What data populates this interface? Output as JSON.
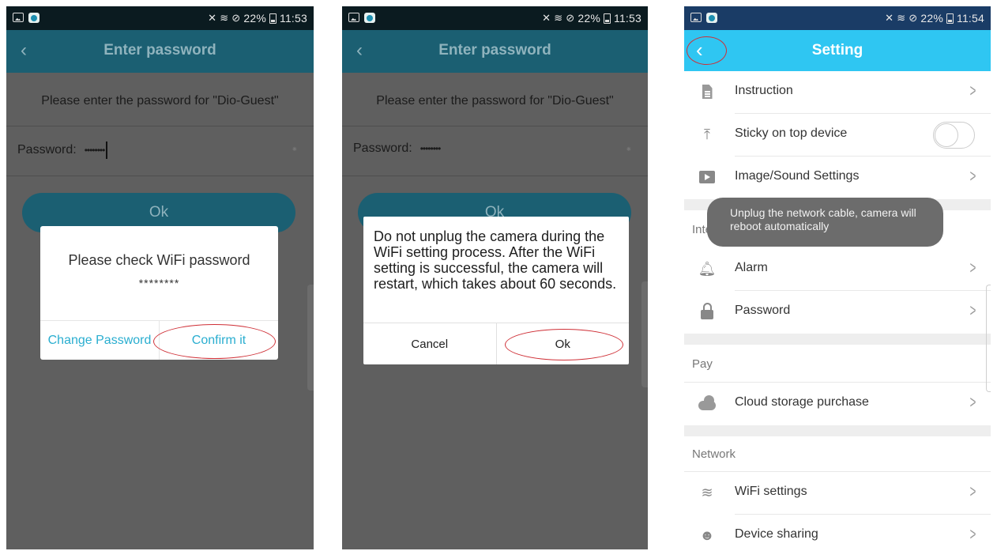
{
  "status": {
    "time_1": "11:53",
    "time_2": "11:53",
    "time_3": "11:54",
    "battery": "22%"
  },
  "screen1": {
    "title": "Enter password",
    "prompt": "Please enter the password for \"Dio-Guest\"",
    "password_label": "Password:",
    "password_value": "••••••••",
    "ok_label": "Ok",
    "dialog": {
      "message": "Please check WiFi password",
      "masked": "********",
      "change_label": "Change Password",
      "confirm_label": "Confirm it"
    }
  },
  "screen2": {
    "title": "Enter password",
    "prompt": "Please enter the password for \"Dio-Guest\"",
    "password_label": "Password:",
    "password_value": "••••••••",
    "ok_label": "Ok",
    "dialog": {
      "message": "Do not unplug the camera during the WiFi setting process. After the WiFi setting is successful, the camera will restart, which takes about 60 seconds.",
      "cancel_label": "Cancel",
      "ok_label": "Ok"
    }
  },
  "screen3": {
    "title": "Setting",
    "rows": {
      "instruction": "Instruction",
      "sticky": "Sticky on top device",
      "image_sound": "Image/Sound Settings",
      "alarm": "Alarm",
      "password": "Password",
      "cloud": "Cloud storage purchase",
      "wifi": "WiFi settings",
      "sharing": "Device sharing"
    },
    "sections": {
      "intelligence_partial": "Intell",
      "pay": "Pay",
      "network": "Network"
    },
    "toast": "Unplug the network cable, camera will reboot automatically",
    "sticky_toggle_on": false
  },
  "colors": {
    "header_dim": "#1b5f72",
    "header_bright": "#2fc6f2",
    "accent": "#2aaed0",
    "annotation": "#cf2f36"
  },
  "icons": [
    "back-arrow-icon",
    "document-icon",
    "pin-top-icon",
    "play-icon",
    "bell-icon",
    "lock-icon",
    "cloud-icon",
    "wifi-icon",
    "people-icon",
    "chevron-right-icon"
  ]
}
